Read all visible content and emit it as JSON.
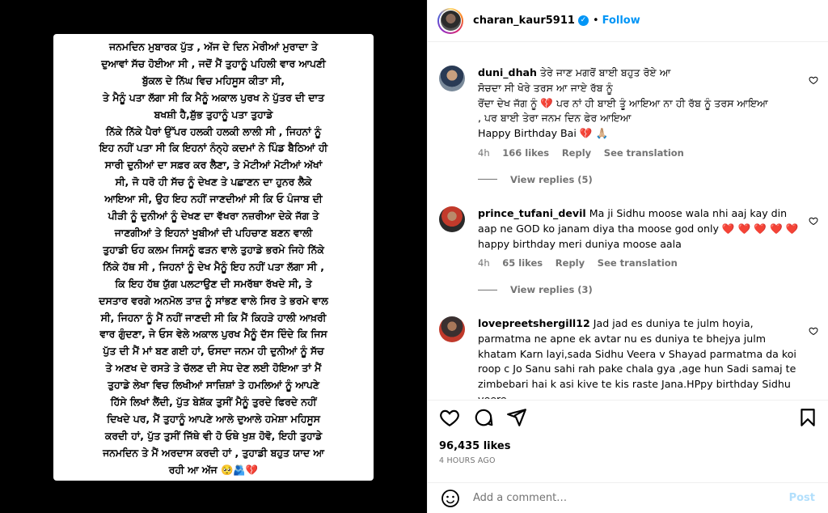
{
  "post": {
    "lines": [
      "ਜਨਮਦਿਨ ਮੁਬਾਰਕ ਪੁੱਤ , ਅੱਜ ਦੇ ਦਿਨ ਮੇਰੀਆਂ ਮੁਰਾਦਾ ਤੇ",
      "ਦੁਆਵਾਂ ਸੱਚ ਹੋਈਆ ਸੀ , ਜਦੋਂ ਮੈਂ ਤੁਹਾਨੂੰ ਪਹਿਲੀ ਵਾਰ ਆਪਣੀ",
      "ਬੁੱਕਲ ਦੇ ਨਿੱਘ ਵਿਚ ਮਹਿਸੂਸ ਕੀਤਾ ਸੀ,",
      "ਤੇ ਮੈਨੂੰ ਪਤਾ ਲੱਗਾ ਸੀ ਕਿ ਮੈਨੂੰ ਅਕਾਲ ਪੁਰਖ ਨੇ ਪੁੱਤਰ ਦੀ ਦਾਤ",
      "ਬਖਸ਼ੀ ਹੈ,ਸ਼ੁੱਭ ਤੁਹਾਨੂੰ ਪਤਾ ਤੁਹਾਡੇ",
      "ਨਿੱਕੇ ਨਿੱਕੇ ਪੈਰਾਂ ਉੱਪਰ ਹਲਕੀ ਹਲਕੀ ਲਾਲੀ ਸੀ , ਜਿਹਨਾਂ ਨੂੰ",
      "ਇਹ ਨਹੀਂ ਪਤਾ ਸੀ ਕਿ ਇਹਨਾਂ ਨੰਨ੍ਹੇ ਕਦਮਾਂ ਨੇ ਪਿੰਡ ਬੈਠਿਆਂ ਹੀ",
      "ਸਾਰੀ ਦੁਨੀਆਂ ਦਾ ਸਫ਼ਰ ਕਰ ਲੈਣਾ, ਤੇ ਮੋਟੀਆਂ ਮੋਟੀਆਂ ਅੱਖਾਂ",
      "ਸੀ, ਜੋ ਧਰੋ ਹੀ ਸੱਚ ਨੂੰ ਦੇਖਣ ਤੇ ਪਛਾਣਨ ਦਾ ਹੁਨਰ ਲੈਕੇ",
      "ਆਇਆ ਸੀ, ਉਹ ਇਹ ਨਹੀਂ ਜਾਣਦੀਆਂ ਸੀ ਕਿ ਓ ਪੰਜਾਬ ਦੀ",
      "ਪੀੜੀ ਨੂੰ ਦੁਨੀਆਂ ਨੂੰ ਦੇਖਣ ਦਾ ਵੱਖਰਾ ਨਜ਼ਰੀਆ ਦੇਕੇ ਜੱਗ ਤੇ",
      "ਜਾਣਗੀਆਂ ਤੇ ਇਹਨਾਂ ਖੂਬੀਆਂ ਦੀ ਪਹਿਚਾਣ ਬਣਨ ਵਾਲੀ",
      "ਤੁਹਾਡੀ ਓਹ ਕਲਮ ਜਿਸਨੂੰ ਫੜਨ ਵਾਲੇ ਤੁਹਾਡੇ ਭਰਮੇ ਜਿਹੇ ਨਿੱਕੇ",
      "ਨਿੱਕੇ ਹੱਥ ਸੀ , ਜਿਹਨਾਂ ਨੂੰ ਦੇਖ ਮੈਨੂੰ ਇਹ ਨਹੀਂ ਪਤਾ ਲੱਗਾ ਸੀ ,",
      "ਕਿ ਇਹ ਹੱਥ ਯੁੱਗ ਪਲਟਾਉਣ ਦੀ ਸਮਰੱਥਾ ਰੱਖਦੇ ਸੀ, ਤੇ",
      "ਦਸਤਾਰ ਵਰਗੇ ਅਨਮੋਲ ਤਾਜ਼ ਨੂੰ ਸਾਂਭਣ ਵਾਲੇ ਸਿਰ ਤੇ ਭਰਮੇ ਵਾਲ",
      "ਸੀ, ਜਿਹਨਾ ਨੂੰ ਮੈਂ ਨਹੀਂ ਜਾਣਦੀ ਸੀ ਕਿ ਮੈਂ ਕਿਹੜੇ ਹਾਲੀ ਆਖ਼ਰੀ",
      "ਵਾਰ ਗੁੰਦਣਾ, ਜੇ ਓਸ ਵੇਲੇ ਅਕਾਲ ਪੁਰਖ ਮੈਨੂੰ ਦੱਸ ਦਿੰਦੇ ਕਿ ਜਿਸ",
      "ਪੁੱਤ ਦੀ ਮੈਂ ਮਾਂ ਬਣ ਗਈ ਹਾਂ, ਓਸਦਾ ਜਨਮ ਹੀ ਦੁਨੀਆਂ ਨੂੰ ਸੱਚ",
      "ਤੇ ਅਣਖ ਦੇ ਰਸਤੇ ਤੇ ਚੱਲਣ ਦੀ ਸੇਧ ਦੇਣ ਲਈ ਹੋਇਆ ਤਾਂ ਮੈਂ",
      "ਤੁਹਾਡੇ ਲੇਖਾ ਵਿਚ ਲਿਖੀਆਂ ਸਾਜ਼ਿਸ਼ਾਂ ਤੇ ਹਮਲਿਆਂ ਨੂੰ ਆਪਣੇ",
      "ਹਿੱਸੇ ਲਿਖਾਂ ਲੈਂਦੀ, ਪੁੱਤ ਬੇਸ਼ੱਕ ਤੁਸੀਂ ਮੈਨੂੰ ਤੁਰਦੇ ਫਿਰਦੇ ਨਹੀਂ",
      "ਦਿਖਦੇ ਪਰ, ਮੈਂ ਤੁਹਾਨੂੰ ਆਪਣੇ ਆਲੇ ਦੁਆਲੇ ਹਮੇਸ਼ਾ ਮਹਿਸੂਸ",
      "ਕਰਦੀ ਹਾਂ, ਪੁੱਤ ਤੁਸੀਂ ਜਿੱਥੇ ਵੀ ਹੋ ਓਥੇ ਖੁਸ਼ ਹੋਵੋ, ਇਹੀ ਤੁਹਾਡੇ",
      "ਜਨਮਦਿਨ ਤੇ ਮੈਂ ਅਰਦਾਸ ਕਰਦੀ ਹਾਂ , ਤੁਹਾਡੀ ਬਹੁਤ ਯਾਦ ਆ",
      "ਰਹੀ ਆ ਅੱਜ 🥺🫂💔"
    ]
  },
  "header": {
    "username": "charan_kaur5911",
    "verified_glyph": "✓",
    "separator": "•",
    "follow_label": "Follow"
  },
  "comments": [
    {
      "username": "duni_dhah",
      "text_1": "ਤੇਰੇ ਜਾਣ ਮਗਰੋਂ ਬਾਈ ਬਹੁਤ ਰੋਏ ਆ",
      "text_2": "ਸੋਚਦਾ ਸੀ ਖੋਰੇ ਤਰਸ ਆ ਜਾਏ ਰੱਬ ਨੂੰ",
      "text_3": "ਰੋਂਦਾ ਦੇਖ ਜੱਗ ਨੂੰ 💔 ਪਰ ਨਾਂ ਹੀ ਬਾਈ ਤੂੰ ਆਇਆ ਨਾ ਹੀ ਰੱਬ ਨੂੰ ਤਰਸ ਆਇਆ",
      "text_4": ", ਪਰ ਬਾਈ ਤੇਰਾ ਜਨਮ ਦਿਨ ਫੇਰ ਆਇਆ",
      "text_5": "Happy Birthday Bai 💔 🙏🏼",
      "time": "4h",
      "likes": "166 likes",
      "reply": "Reply",
      "translate": "See translation",
      "view_replies": "View replies (5)"
    },
    {
      "username": "prince_tufani_devil",
      "text": "Ma ji Sidhu moose wala nhi aaj kay din aap ne GOD ko janam diya tha moose god only ❤️ ❤️ ❤️ ❤️ ❤️ happy birthday meri duniya moose aala",
      "time": "4h",
      "likes": "65 likes",
      "reply": "Reply",
      "translate": "See translation",
      "view_replies": "View replies (3)"
    },
    {
      "username": "lovepreetshergill12",
      "text": "Jad jad es duniya te julm hoyia, parmatma ne apne ek avtar nu es duniya te bhejya julm khatam Karn layi,sada Sidhu Veera v Shayad parmatma da koi roop c Jo Sanu sahi rah pake chala gya ,age hun Sadi samaj te zimbebari hai k asi kive te kis raste Jana.HPpy birthday Sidhu veere,"
    }
  ],
  "footer": {
    "likes": "96,435 likes",
    "time": "4 HOURS AGO",
    "add_comment_placeholder": "Add a comment…",
    "post_label": "Post"
  },
  "colors": {
    "accent": "#0095f6",
    "muted": "#737373",
    "post_btn_disabled": "#b2dffc"
  },
  "icons": [
    "heart-icon",
    "comment-icon",
    "share-icon",
    "bookmark-icon",
    "emoji-icon",
    "verified-badge-icon"
  ]
}
